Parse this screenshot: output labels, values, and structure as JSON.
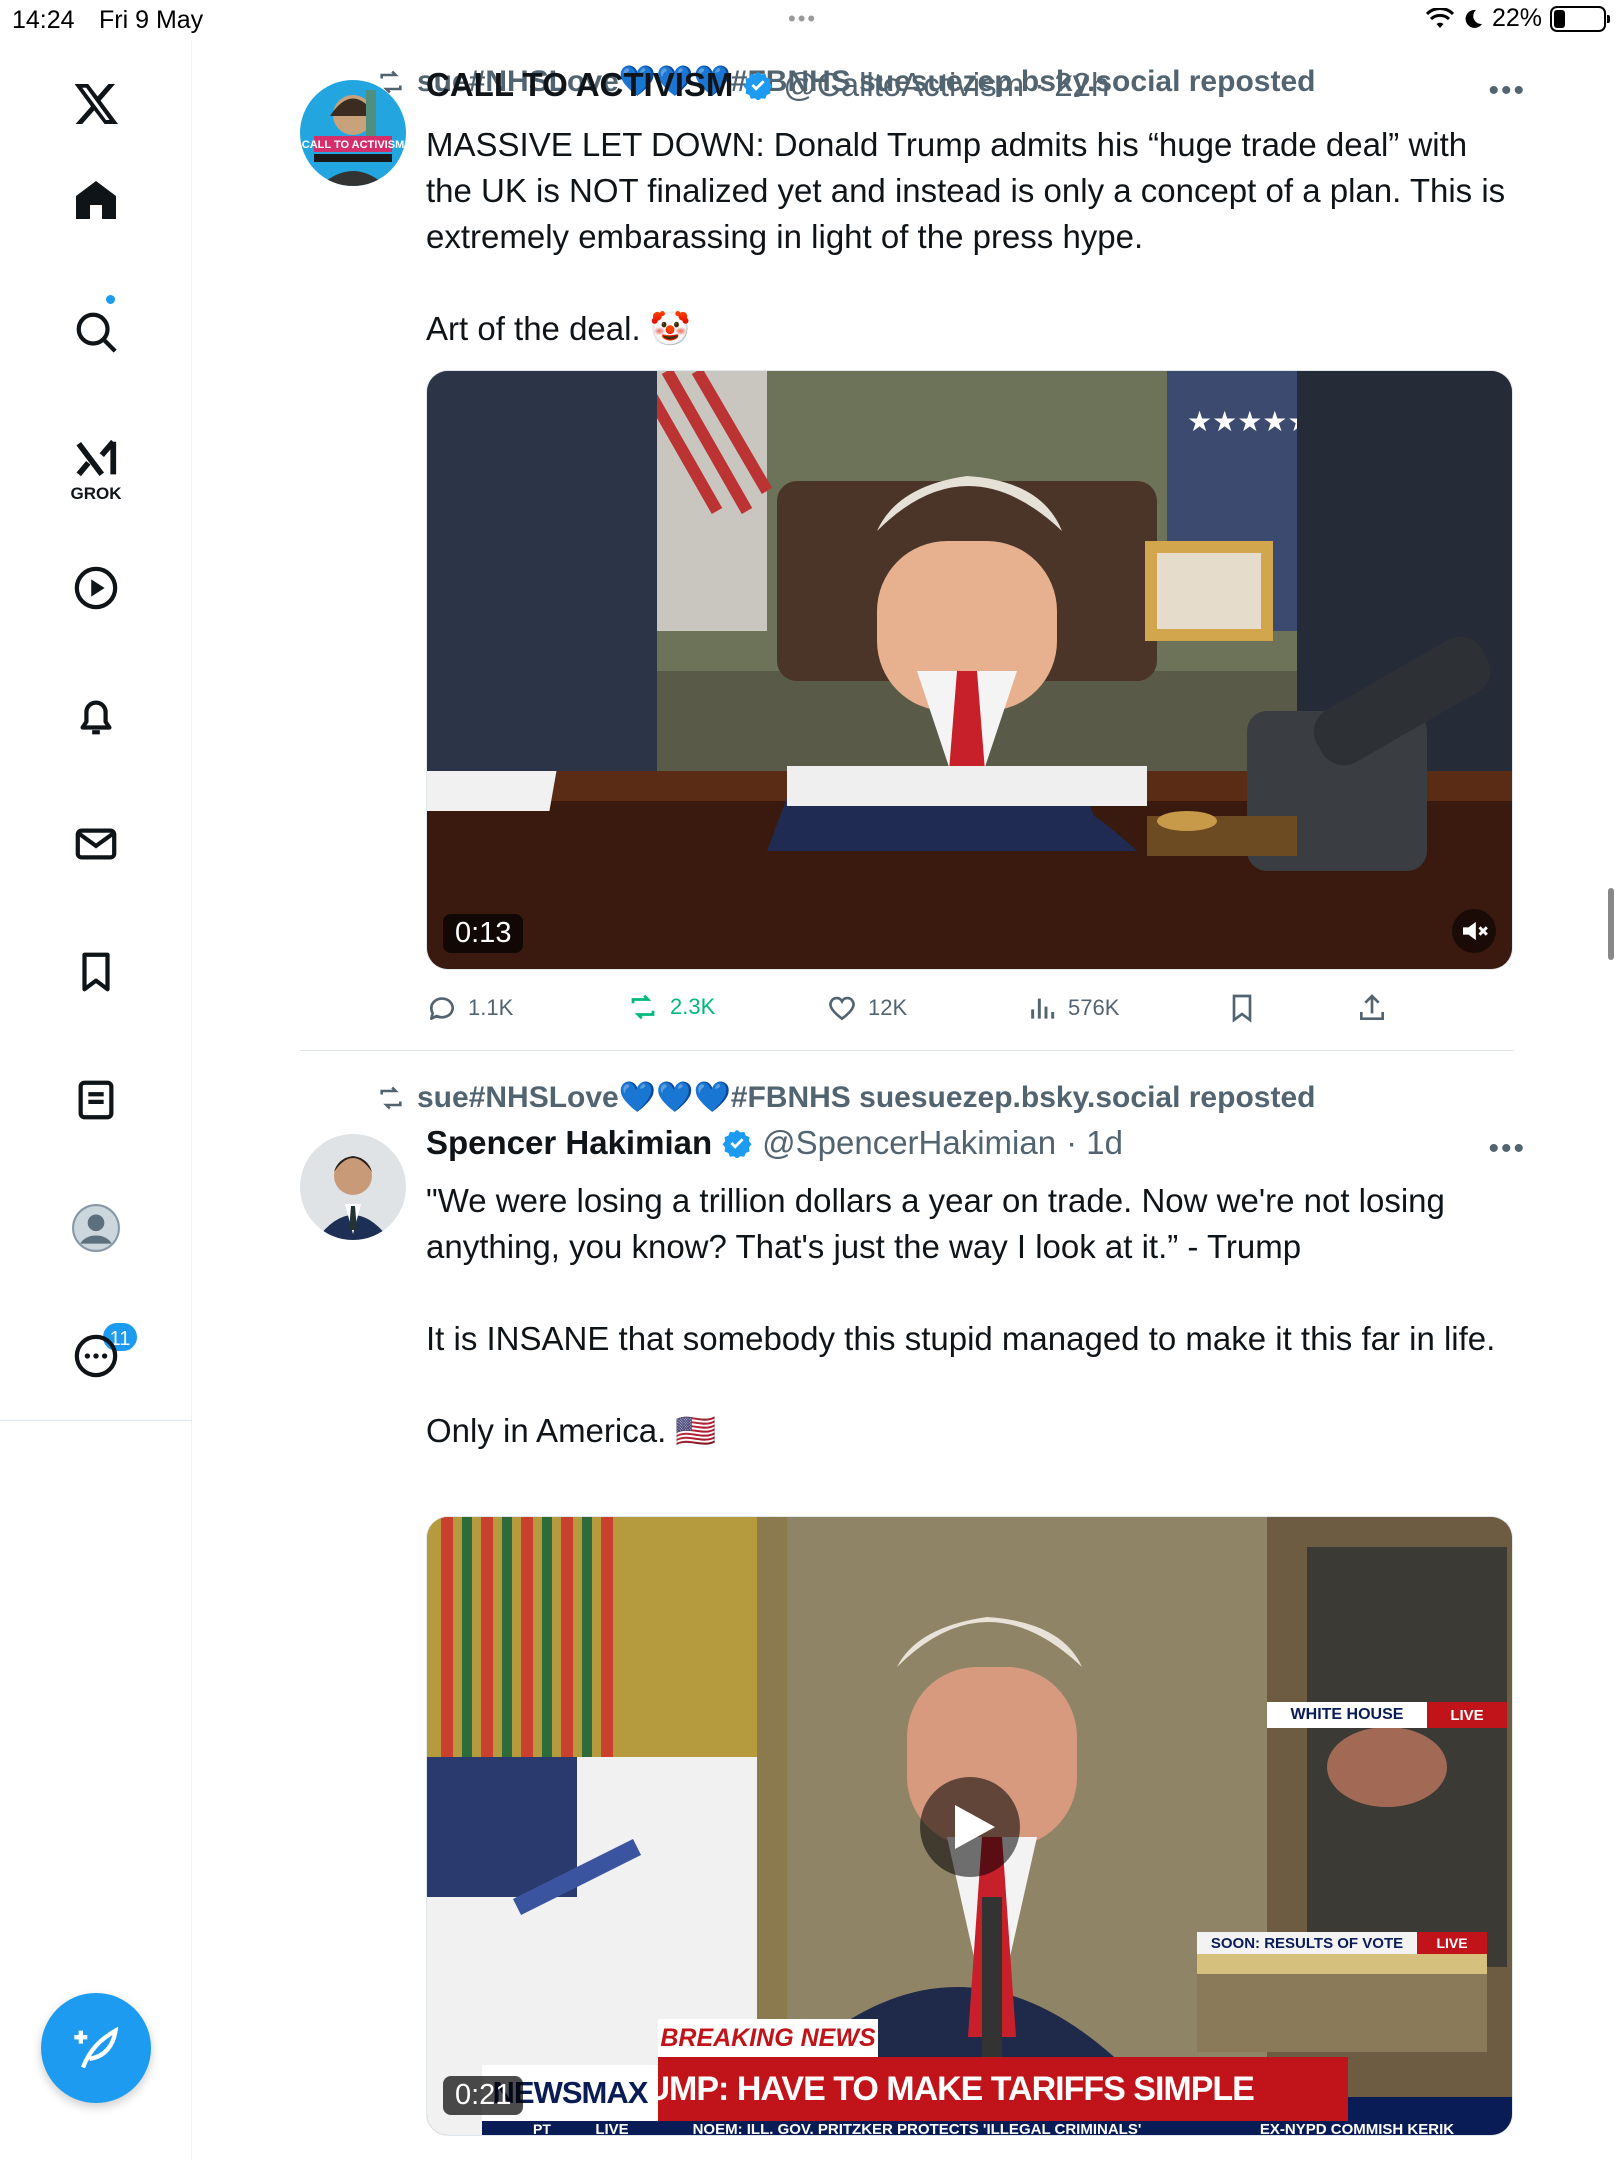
{
  "status_bar": {
    "time": "14:24",
    "date": "Fri 9 May",
    "battery": "22%"
  },
  "sidebar": {
    "grok_label": "GROK",
    "notifications_count": "11"
  },
  "tweets": [
    {
      "repost_label": "sue#NHSLove💙💙💙#FBNHS suesuezep.bsky.social reposted",
      "name": "CALL TO ACTIVISM",
      "handle": "@CalltoActivism",
      "time": "· 22h",
      "text": "MASSIVE LET DOWN: Donald Trump admits his “huge trade deal” with the UK is NOT finalized yet and instead is only a concept of a plan. This is extremely embarassing in light of the press hype.\n\nArt of the deal. 🤡",
      "duration": "0:13",
      "stats": {
        "replies": "1.1K",
        "reposts": "2.3K",
        "likes": "12K",
        "views": "576K"
      }
    },
    {
      "repost_label": "sue#NHSLove💙💙💙#FBNHS suesuezep.bsky.social reposted",
      "name": "Spencer Hakimian",
      "handle": "@SpencerHakimian",
      "time": "· 1d",
      "text": "\"We were losing a trillion dollars a year on trade. Now we're not losing anything, you know? That's just the way I look at it.” - Trump\n\nIt is INSANE that somebody this stupid managed to make it this far in life.\n\nOnly in America. 🇺🇸",
      "duration": "0:21",
      "overlay": {
        "white_house": "WHITE HOUSE",
        "live": "LIVE",
        "soon": "SOON: RESULTS OF VOTE",
        "breaking": "BREAKING NEWS",
        "headline": "TRUMP: HAVE TO MAKE TARIFFS SIMPLE",
        "network": "NEWSMAX",
        "ticker_left": "PT",
        "ticker_live": "LIVE",
        "ticker": "NOEM: ILL. GOV. PRITZKER PROTECTS 'ILLEGAL CRIMINALS'",
        "ticker_right": "EX-NYPD COMMISH KERIK"
      }
    }
  ],
  "colors": {
    "accent": "#1d9bf0",
    "repost_green": "#00ba7c",
    "muted": "#536471"
  }
}
